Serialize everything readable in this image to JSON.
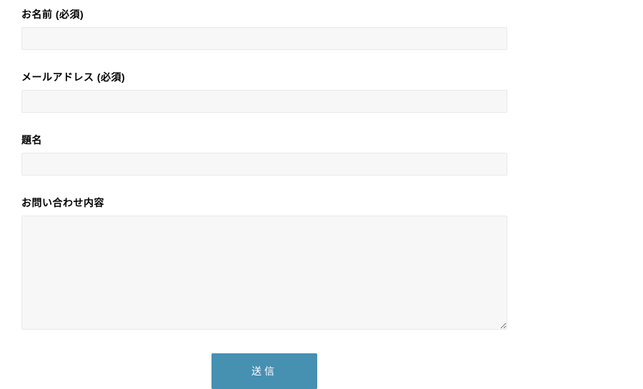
{
  "form": {
    "fields": {
      "name": {
        "label": "お名前 (必須)",
        "value": ""
      },
      "email": {
        "label": "メールアドレス (必須)",
        "value": ""
      },
      "subject": {
        "label": "題名",
        "value": ""
      },
      "message": {
        "label": "お問い合わせ内容",
        "value": ""
      }
    },
    "submit_label": "送信"
  },
  "colors": {
    "submit_button_bg": "#4690b2",
    "input_bg": "#f7f7f7",
    "input_border": "#e9e9e9"
  }
}
